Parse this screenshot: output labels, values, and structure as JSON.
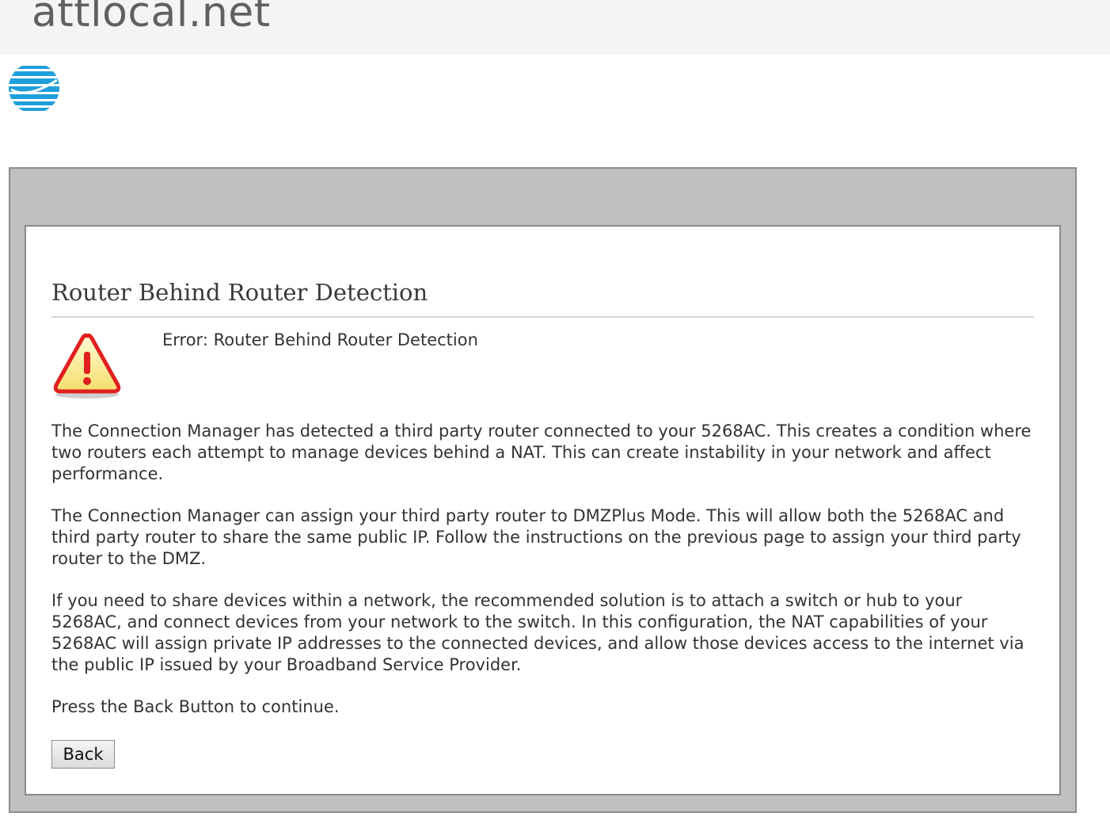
{
  "site": {
    "title": "attlocal.net"
  },
  "logo": {
    "icon": "att-globe-icon",
    "colors": [
      "#1f9fdb",
      "#0568ae"
    ]
  },
  "page": {
    "heading": "Router Behind Router Detection",
    "error_icon": "warning-icon",
    "error_text": "Error: Router Behind Router Detection",
    "paragraphs": [
      "The Connection Manager has detected a third party router connected to your 5268AC. This creates a condition where two routers each attempt to manage devices behind a NAT. This can create instability in your network and affect performance.",
      "The Connection Manager can assign your third party router to DMZPlus Mode. This will allow both the 5268AC and third party router to share the same public IP. Follow the instructions on the previous page to assign your third party router to the DMZ.",
      "If you need to share devices within a network, the recommended solution is to attach a switch or hub to your 5268AC, and connect devices from your network to the switch. In this configuration, the NAT capabilities of your 5268AC will assign private IP addresses to the connected devices, and allow those devices access to the internet via the public IP issued by your Broadband Service Provider.",
      "Press the Back Button to continue."
    ],
    "back_button_label": "Back"
  },
  "colors": {
    "frame_gray": "#c0c0c0",
    "warning_red": "#e02020",
    "warning_fill": "#fff6a8"
  }
}
